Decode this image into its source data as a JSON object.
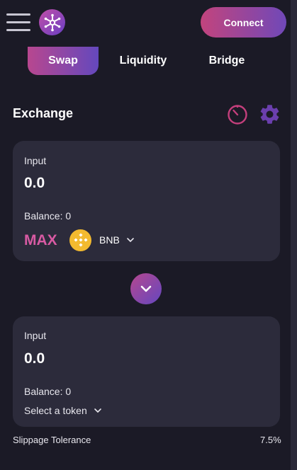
{
  "header": {
    "connect_label": "Connect",
    "menu_icon": "hamburger-menu-icon",
    "logo_icon": "app-logo-icon"
  },
  "tabs": [
    {
      "label": "Swap",
      "active": true
    },
    {
      "label": "Liquidity",
      "active": false
    },
    {
      "label": "Bridge",
      "active": false
    }
  ],
  "exchange": {
    "title": "Exchange",
    "history_icon": "history-timer-icon",
    "settings_icon": "gear-icon"
  },
  "input_card": {
    "label": "Input",
    "value": "0.0",
    "balance": "Balance: 0",
    "max_label": "MAX",
    "token": "BNB"
  },
  "switch": {
    "icon": "chevron-down-icon"
  },
  "output_card": {
    "label": "Input",
    "value": "0.0",
    "balance": "Balance: 0",
    "select_label": "Select a token"
  },
  "slippage": {
    "label": "Slippage Tolerance",
    "value": "7.5%"
  },
  "colors": {
    "background": "#1b1a26",
    "card": "#2c2b3b",
    "accent_pink": "#d85aa3",
    "accent_purple": "#6448bd",
    "bnb_yellow": "#f3ba2f"
  }
}
